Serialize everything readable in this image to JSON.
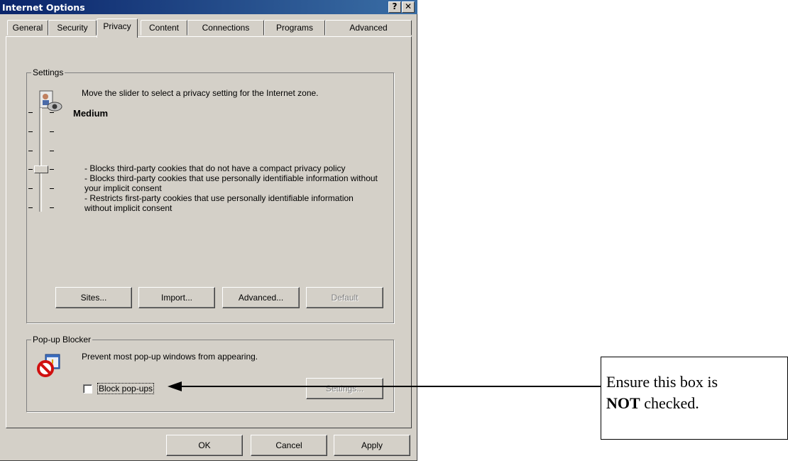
{
  "window": {
    "title": "Internet Options",
    "help_glyph": "?",
    "close_glyph": "✕"
  },
  "tabs": [
    {
      "label": "General"
    },
    {
      "label": "Security"
    },
    {
      "label": "Privacy",
      "active": true
    },
    {
      "label": "Content"
    },
    {
      "label": "Connections"
    },
    {
      "label": "Programs"
    },
    {
      "label": "Advanced"
    }
  ],
  "settings": {
    "legend": "Settings",
    "intro": "Move the slider to select a privacy setting for the Internet zone.",
    "level_name": "Medium",
    "description": "- Blocks third-party cookies that do not have a compact privacy policy\n- Blocks third-party cookies that use personally identifiable information without your implicit consent\n- Restricts first-party cookies that use personally identifiable information without implicit consent",
    "slider": {
      "level_index": 3,
      "levels": 6
    },
    "buttons": {
      "sites": "Sites...",
      "import": "Import...",
      "advanced": "Advanced...",
      "default": "Default"
    }
  },
  "popup_blocker": {
    "legend": "Pop-up Blocker",
    "intro": "Prevent most pop-up windows from appearing.",
    "checkbox_label": "Block pop-ups",
    "checked": false,
    "settings_button": "Settings..."
  },
  "footer": {
    "ok": "OK",
    "cancel": "Cancel",
    "apply": "Apply"
  },
  "annotation": {
    "line1": "Ensure this box is",
    "emphasis": "NOT",
    "line2_rest": " checked."
  }
}
